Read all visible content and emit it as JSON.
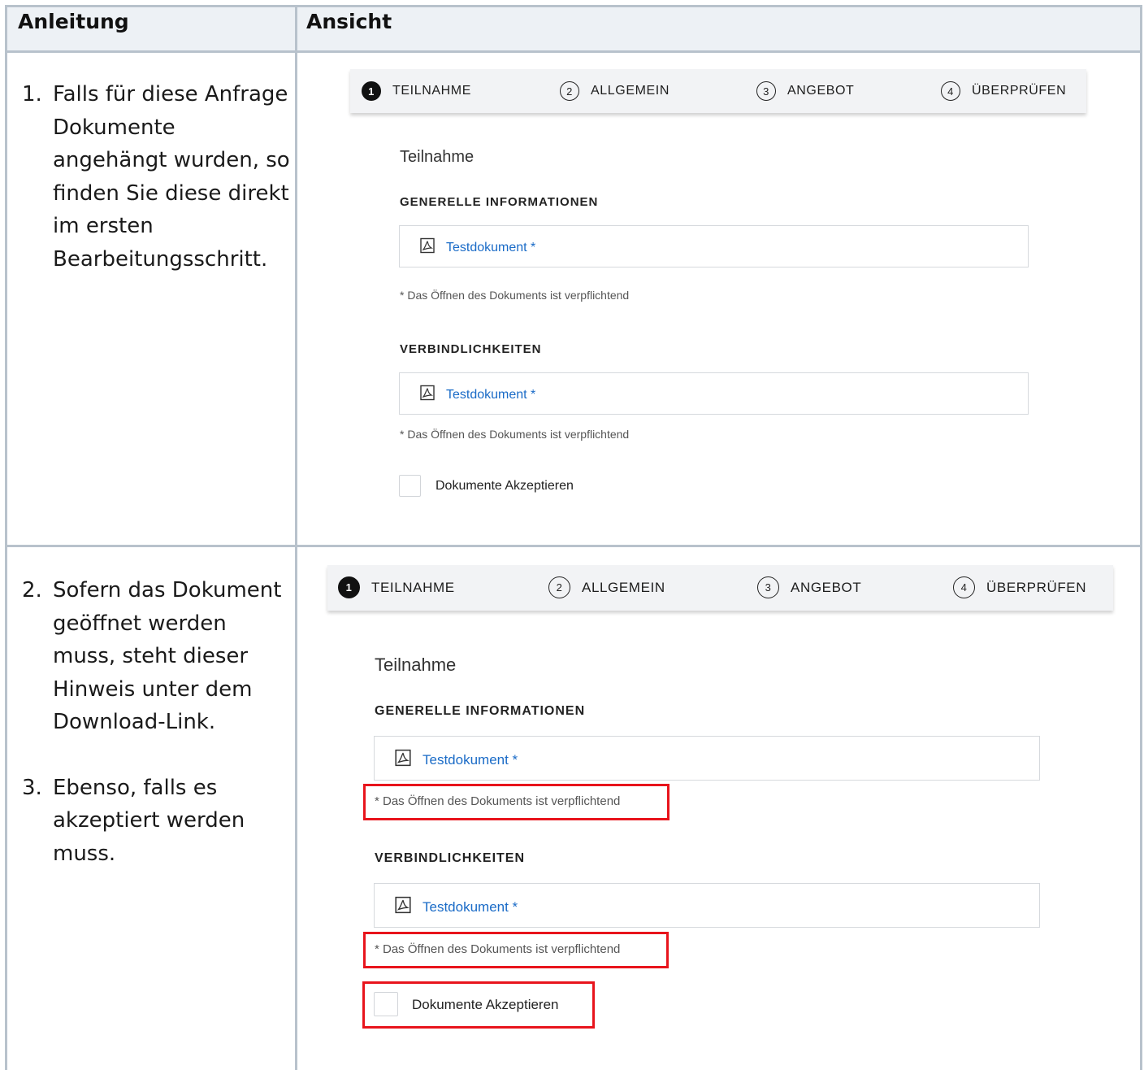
{
  "table": {
    "headers": {
      "instructions": "Anleitung",
      "view": "Ansicht"
    }
  },
  "rows": [
    {
      "instructions": [
        {
          "num": "1.",
          "text": "Falls für diese Anfrage Dokumente angehängt wurden, so finden Sie diese direkt im ersten Bearbeitungsschritt."
        }
      ]
    },
    {
      "instructions": [
        {
          "num": "2.",
          "text": "Sofern das Dokument geöffnet werden muss, steht dieser Hinweis unter dem Download-Link."
        },
        {
          "num": "3.",
          "text": "Ebenso, falls es akzeptiert werden muss."
        }
      ]
    }
  ],
  "wizard": {
    "steps": [
      {
        "number": "1",
        "label": "TEILNAHME",
        "active": true
      },
      {
        "number": "2",
        "label": "ALLGEMEIN",
        "active": false
      },
      {
        "number": "3",
        "label": "ANGEBOT",
        "active": false
      },
      {
        "number": "4",
        "label": "ÜBERPRÜFEN",
        "active": false
      }
    ],
    "title": "Teilnahme",
    "sections": [
      {
        "title": "GENERELLE INFORMATIONEN",
        "document": "Testdokument *",
        "note": "* Das Öffnen des Dokuments ist verpflichtend"
      },
      {
        "title": "VERBINDLICHKEITEN",
        "document": "Testdokument *",
        "note": "* Das Öffnen des Dokuments ist verpflichtend"
      }
    ],
    "accept_label": "Dokumente Akzeptieren",
    "accept_checked": false
  },
  "colors": {
    "highlight": "#e8141c",
    "link": "#1a6bc7",
    "grid": "#b8c2cc",
    "header_bg": "#edf1f5"
  }
}
